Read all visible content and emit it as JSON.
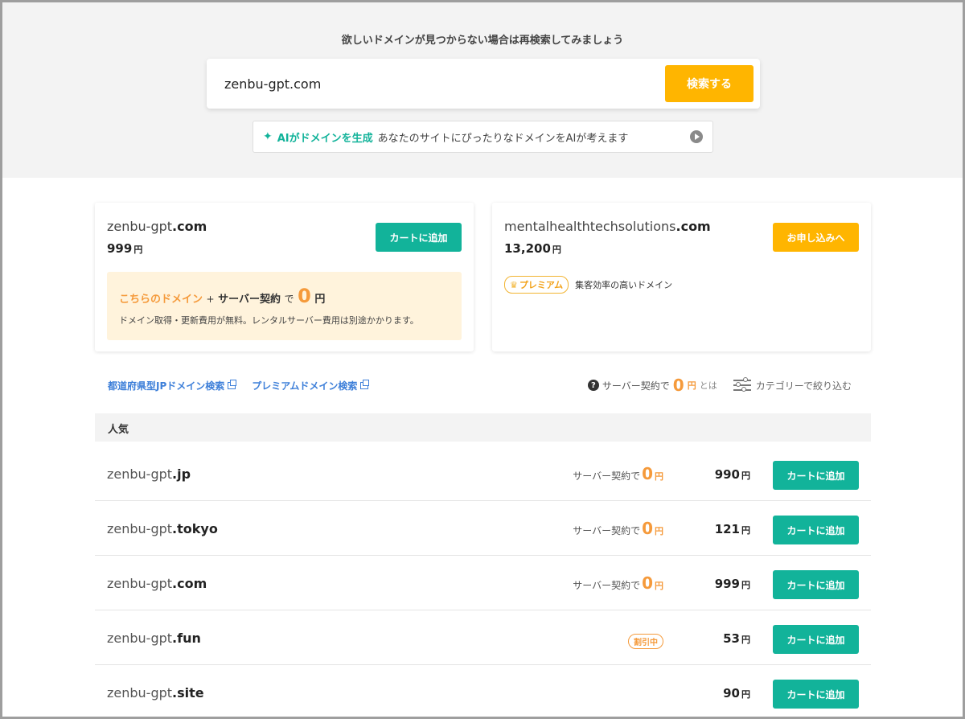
{
  "hero": {
    "heading": "欲しいドメインが見つからない場合は再検索してみましょう",
    "search_value": "zenbu-gpt.com",
    "search_button": "検索する"
  },
  "ai_banner": {
    "label": "AIがドメインを生成",
    "description": "あなたのサイトにぴったりなドメインをAIが考えます"
  },
  "card_left": {
    "sld": "zenbu-gpt",
    "tld": ".com",
    "price": "999",
    "yen": "円",
    "button": "カートに追加",
    "promo": {
      "accent": "こちらのドメイン",
      "plus": "+",
      "bold": "サーバー契約",
      "de": "で",
      "zero": "0",
      "yen": "円",
      "note": "ドメイン取得・更新費用が無料。レンタルサーバー費用は別途かかります。"
    }
  },
  "card_right": {
    "sld": "mentalhealthtechsolutions",
    "tld": ".com",
    "price": "13,200",
    "yen": "円",
    "button": "お申し込みへ",
    "badge": "プレミアム",
    "badge_text": "集客効率の高いドメイン"
  },
  "links": {
    "jp_search": "都道府県型JPドメイン検索",
    "premium_search": "プレミアムドメイン検索"
  },
  "tools": {
    "help_q": "?",
    "server_label": "サーバー契約で",
    "zero": "0",
    "yen": "円",
    "toha": "とは",
    "filter": "カテゴリーで絞り込む"
  },
  "section": {
    "title": "人気"
  },
  "rows": [
    {
      "sld": "zenbu-gpt",
      "tld": ".jp",
      "server_label": "サーバー契約で",
      "zero": "0",
      "yen_small": "円",
      "price": "990",
      "yen": "円",
      "button": "カートに追加"
    },
    {
      "sld": "zenbu-gpt",
      "tld": ".tokyo",
      "server_label": "サーバー契約で",
      "zero": "0",
      "yen_small": "円",
      "price": "121",
      "yen": "円",
      "button": "カートに追加"
    },
    {
      "sld": "zenbu-gpt",
      "tld": ".com",
      "server_label": "サーバー契約で",
      "zero": "0",
      "yen_small": "円",
      "price": "999",
      "yen": "円",
      "button": "カートに追加"
    },
    {
      "sld": "zenbu-gpt",
      "tld": ".fun",
      "badge": "割引中",
      "price": "53",
      "yen": "円",
      "button": "カートに追加"
    },
    {
      "sld": "zenbu-gpt",
      "tld": ".site",
      "price": "90",
      "yen": "円",
      "button": "カートに追加"
    }
  ],
  "colors": {
    "accent_green": "#12b39a",
    "accent_orange": "#ffb500",
    "highlight": "#f59a3b",
    "link_blue": "#3d7fd9"
  }
}
